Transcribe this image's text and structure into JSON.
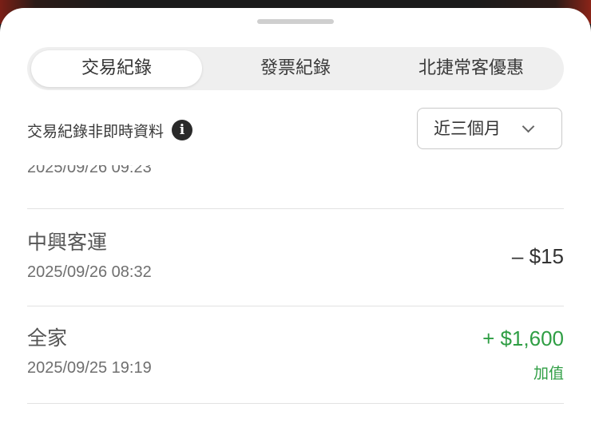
{
  "tabs": [
    {
      "label": "交易紀錄",
      "active": true
    },
    {
      "label": "發票紀錄",
      "active": false
    },
    {
      "label": "北捷常客優惠",
      "active": false
    }
  ],
  "filter": {
    "note": "交易紀錄非即時資料",
    "info_icon": "info-icon",
    "period_selected": "近三個月"
  },
  "transactions": [
    {
      "merchant": "",
      "datetime": "2025/09/26 09:23",
      "amount": "",
      "type": ""
    },
    {
      "merchant": "中興客運",
      "datetime": "2025/09/26 08:32",
      "amount": "– $15",
      "type": ""
    },
    {
      "merchant": "全家",
      "datetime": "2025/09/25 19:19",
      "amount": "+ $1,600",
      "type": "加值"
    }
  ],
  "colors": {
    "accent_green": "#2f9e44",
    "text_dark": "#333333",
    "text_muted": "#6f6f6f"
  }
}
